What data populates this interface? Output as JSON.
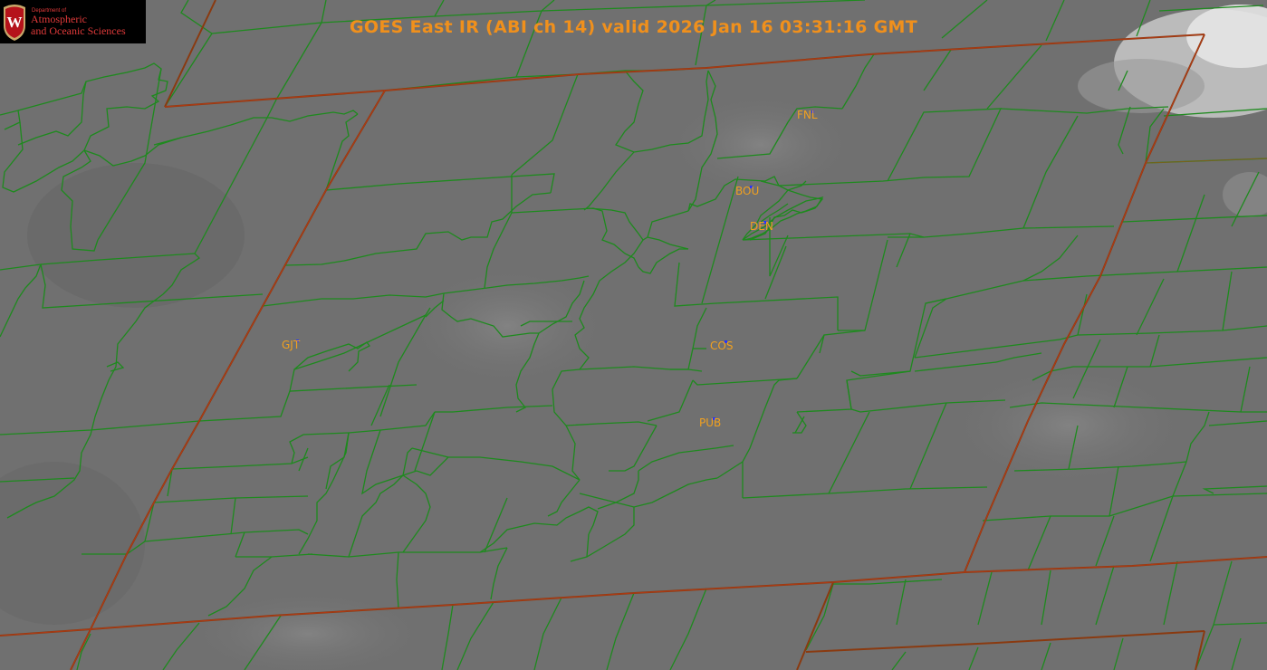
{
  "logo": {
    "department": "Department of",
    "line1": "Atmospheric",
    "line2": "and Oceanic Sciences",
    "seal_letter": "W",
    "seal_color": "#b5121b"
  },
  "title": "GOES East IR (ABI ch 14) valid 2026 Jan 16 03:31:16 GMT",
  "colors": {
    "title": "#f0901c",
    "station": "#f0a020",
    "county_lines": "#1e8a1e",
    "state_lines": "#8a3a10",
    "station_marker": "#2233ff"
  },
  "stations": {
    "fnl": "FNL",
    "bou": "BOU",
    "den": "DEN",
    "gjt": "GJT",
    "cos": "COS",
    "pub": "PUB"
  }
}
